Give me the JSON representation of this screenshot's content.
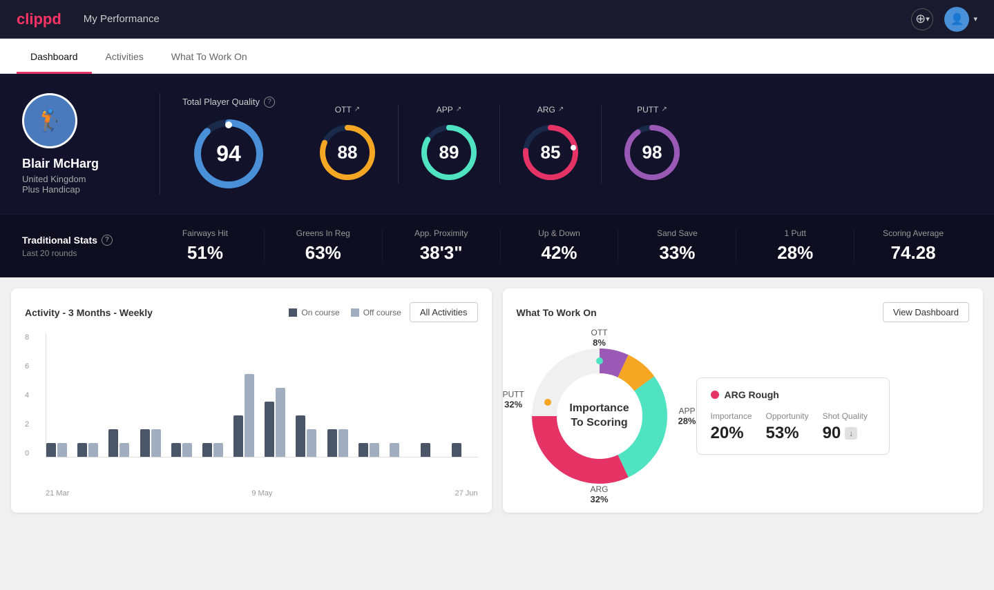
{
  "app": {
    "logo": "clippd",
    "header_title": "My Performance"
  },
  "nav": {
    "tabs": [
      {
        "label": "Dashboard",
        "active": true
      },
      {
        "label": "Activities",
        "active": false
      },
      {
        "label": "What To Work On",
        "active": false
      }
    ]
  },
  "player": {
    "name": "Blair McHarg",
    "country": "United Kingdom",
    "handicap": "Plus Handicap",
    "avatar_emoji": "🏌️"
  },
  "total_quality": {
    "label": "Total Player Quality",
    "score": "94",
    "ring_color": "#4a90d9"
  },
  "sub_scores": [
    {
      "label": "OTT",
      "score": "88",
      "ring_color": "#f5a623",
      "trend": "↗"
    },
    {
      "label": "APP",
      "score": "89",
      "ring_color": "#50e3c2",
      "trend": "↗"
    },
    {
      "label": "ARG",
      "score": "85",
      "ring_color": "#e63366",
      "trend": "↗"
    },
    {
      "label": "PUTT",
      "score": "98",
      "ring_color": "#9b59b6",
      "trend": "↗"
    }
  ],
  "trad_stats": {
    "title": "Traditional Stats",
    "subtitle": "Last 20 rounds",
    "items": [
      {
        "name": "Fairways Hit",
        "value": "51%"
      },
      {
        "name": "Greens In Reg",
        "value": "63%"
      },
      {
        "name": "App. Proximity",
        "value": "38'3\""
      },
      {
        "name": "Up & Down",
        "value": "42%"
      },
      {
        "name": "Sand Save",
        "value": "33%"
      },
      {
        "name": "1 Putt",
        "value": "28%"
      },
      {
        "name": "Scoring Average",
        "value": "74.28"
      }
    ]
  },
  "activity_chart": {
    "title": "Activity - 3 Months - Weekly",
    "legend": {
      "on_course": "On course",
      "off_course": "Off course"
    },
    "all_activities_btn": "All Activities",
    "x_labels": [
      "21 Mar",
      "9 May",
      "27 Jun"
    ],
    "y_labels": [
      "8",
      "6",
      "4",
      "2",
      "0"
    ],
    "bars": [
      {
        "on": 1,
        "off": 1
      },
      {
        "on": 1,
        "off": 1
      },
      {
        "on": 2,
        "off": 1
      },
      {
        "on": 2,
        "off": 2
      },
      {
        "on": 1,
        "off": 1
      },
      {
        "on": 1,
        "off": 1
      },
      {
        "on": 3,
        "off": 6
      },
      {
        "on": 4,
        "off": 5
      },
      {
        "on": 3,
        "off": 2
      },
      {
        "on": 2,
        "off": 2
      },
      {
        "on": 1,
        "off": 1
      },
      {
        "on": 0,
        "off": 1
      },
      {
        "on": 1,
        "off": 0
      },
      {
        "on": 1,
        "off": 0
      }
    ]
  },
  "work_on": {
    "title": "What To Work On",
    "view_dashboard_btn": "View Dashboard",
    "donut_center": "Importance\nTo Scoring",
    "segments": [
      {
        "label": "OTT",
        "pct": "8%",
        "color": "#f5a623",
        "angle_deg": 8
      },
      {
        "label": "APP",
        "pct": "28%",
        "color": "#50e3c2",
        "angle_deg": 28
      },
      {
        "label": "ARG",
        "pct": "32%",
        "color": "#e63366",
        "angle_deg": 32
      },
      {
        "label": "PUTT",
        "pct": "32%",
        "color": "#9b59b6",
        "angle_deg": 32
      }
    ],
    "info_card": {
      "title": "ARG Rough",
      "dot_color": "#e63366",
      "metrics": [
        {
          "label": "Importance",
          "value": "20%"
        },
        {
          "label": "Opportunity",
          "value": "53%"
        },
        {
          "label": "Shot Quality",
          "value": "90",
          "badge": "↓"
        }
      ]
    }
  },
  "icons": {
    "plus_circle": "⊕",
    "chevron_down": "▾",
    "info": "?",
    "trend_up": "↗"
  }
}
